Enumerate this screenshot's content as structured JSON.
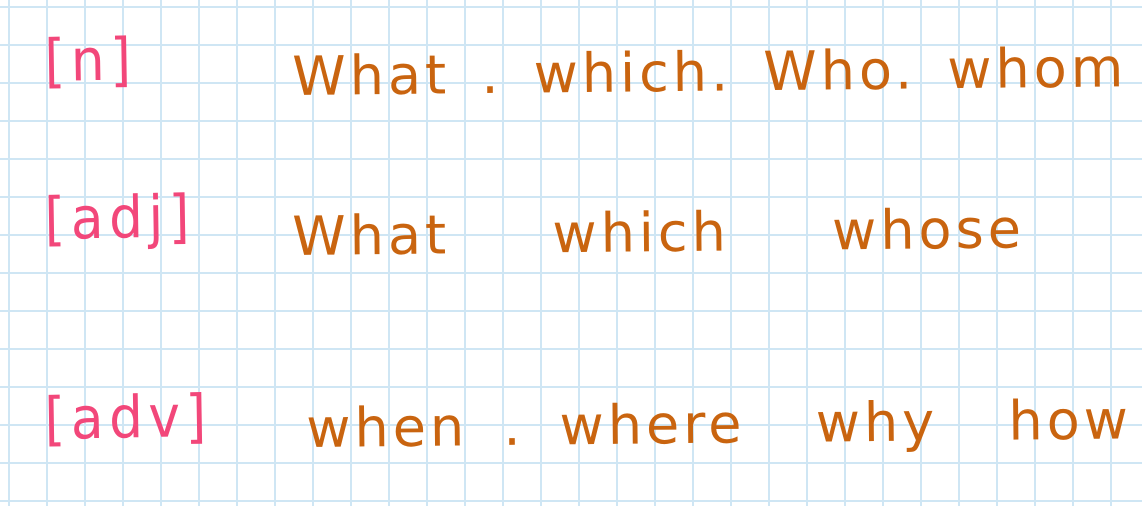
{
  "rows": [
    {
      "tag": "[n]",
      "words": "What . which. Who. whom"
    },
    {
      "tag": "[adj]",
      "words": "What  which  whose"
    },
    {
      "tag": "[adv]",
      "words": "when . where  why  how"
    }
  ],
  "colors": {
    "tag": "#f2477a",
    "words": "#c9640f",
    "grid": "#cfe6f4",
    "paper": "#ffffff"
  }
}
